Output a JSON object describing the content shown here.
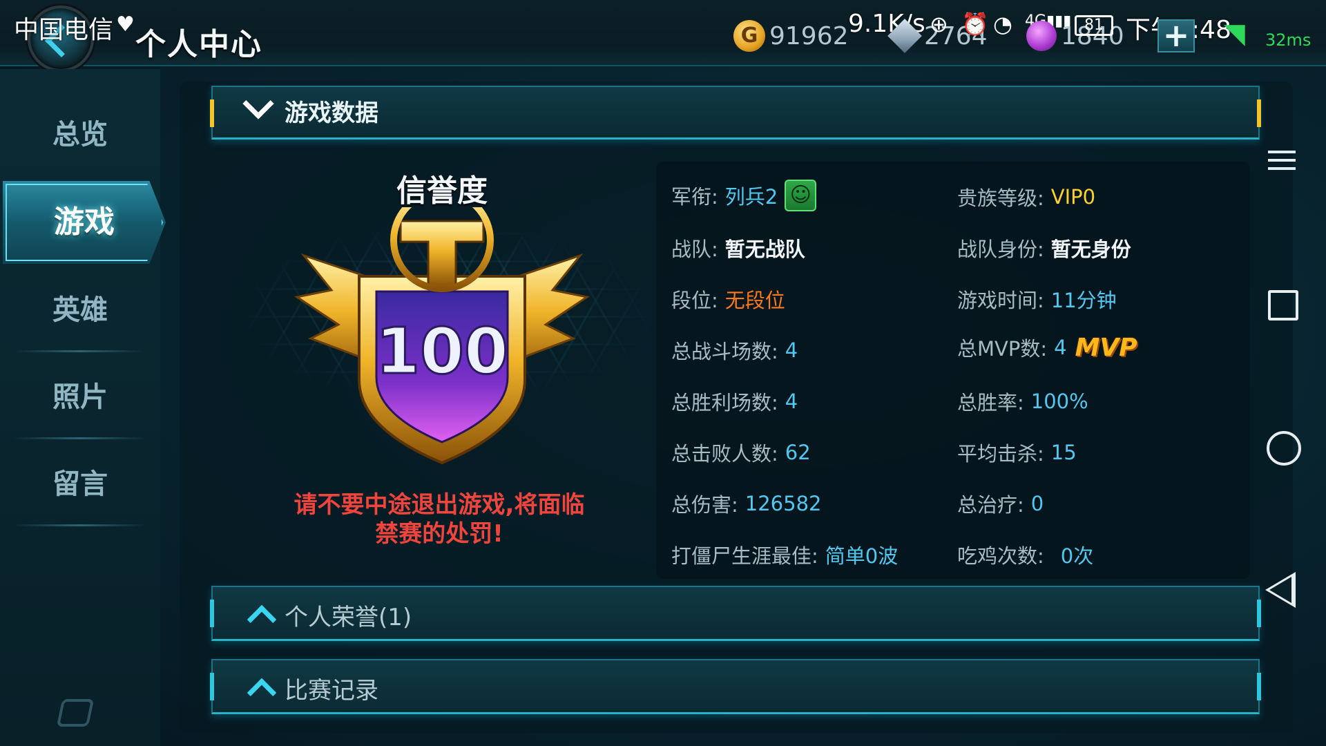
{
  "status_bar": {
    "carrier": "中国电信",
    "net_speed": "9.1K/s",
    "battery": "81",
    "time": "下午2:48",
    "ping": "32ms"
  },
  "header": {
    "title": "个人中心",
    "gold": "91962",
    "diamond": "2764",
    "gem": "1840"
  },
  "sidebar": {
    "items": [
      {
        "label": "总览",
        "active": false
      },
      {
        "label": "游戏",
        "active": true
      },
      {
        "label": "英雄",
        "active": false
      },
      {
        "label": "照片",
        "active": false
      },
      {
        "label": "留言",
        "active": false
      }
    ]
  },
  "sections": {
    "game_data": "游戏数据",
    "honors": "个人荣誉(1)",
    "match_records": "比赛记录"
  },
  "credit": {
    "title": "信誉度",
    "score": "100",
    "warning_line1": "请不要中途退出游戏,将面临",
    "warning_line2": "禁赛的处罚!"
  },
  "stats": {
    "rank_label": "军衔:",
    "rank_value": "列兵2",
    "noble_label": "贵族等级:",
    "noble_value": "VIP0",
    "team_label": "战队:",
    "team_value": "暂无战队",
    "team_role_label": "战队身份:",
    "team_role_value": "暂无身份",
    "tier_label": "段位:",
    "tier_value": "无段位",
    "playtime_label": "游戏时间:",
    "playtime_value": "11分钟",
    "battles_label": "总战斗场数:",
    "battles_value": "4",
    "mvp_label": "总MVP数:",
    "mvp_value": "4",
    "mvp_badge": "MVP",
    "wins_label": "总胜利场数:",
    "wins_value": "4",
    "winrate_label": "总胜率:",
    "winrate_value": "100%",
    "kills_label": "总击败人数:",
    "kills_value": "62",
    "avg_kills_label": "平均击杀:",
    "avg_kills_value": "15",
    "damage_label": "总伤害:",
    "damage_value": "126582",
    "healing_label": "总治疗:",
    "healing_value": "0",
    "zombie_label": "打僵尸生涯最佳:",
    "zombie_value": "简单0波",
    "chicken_label": "吃鸡次数:",
    "chicken_value": "0次"
  },
  "colors": {
    "accent": "#27b2c8",
    "value_blue": "#51c8f0",
    "warning_red": "#f0453d",
    "tier_orange": "#ff7a1c",
    "vip_gold": "#ffd22c"
  }
}
